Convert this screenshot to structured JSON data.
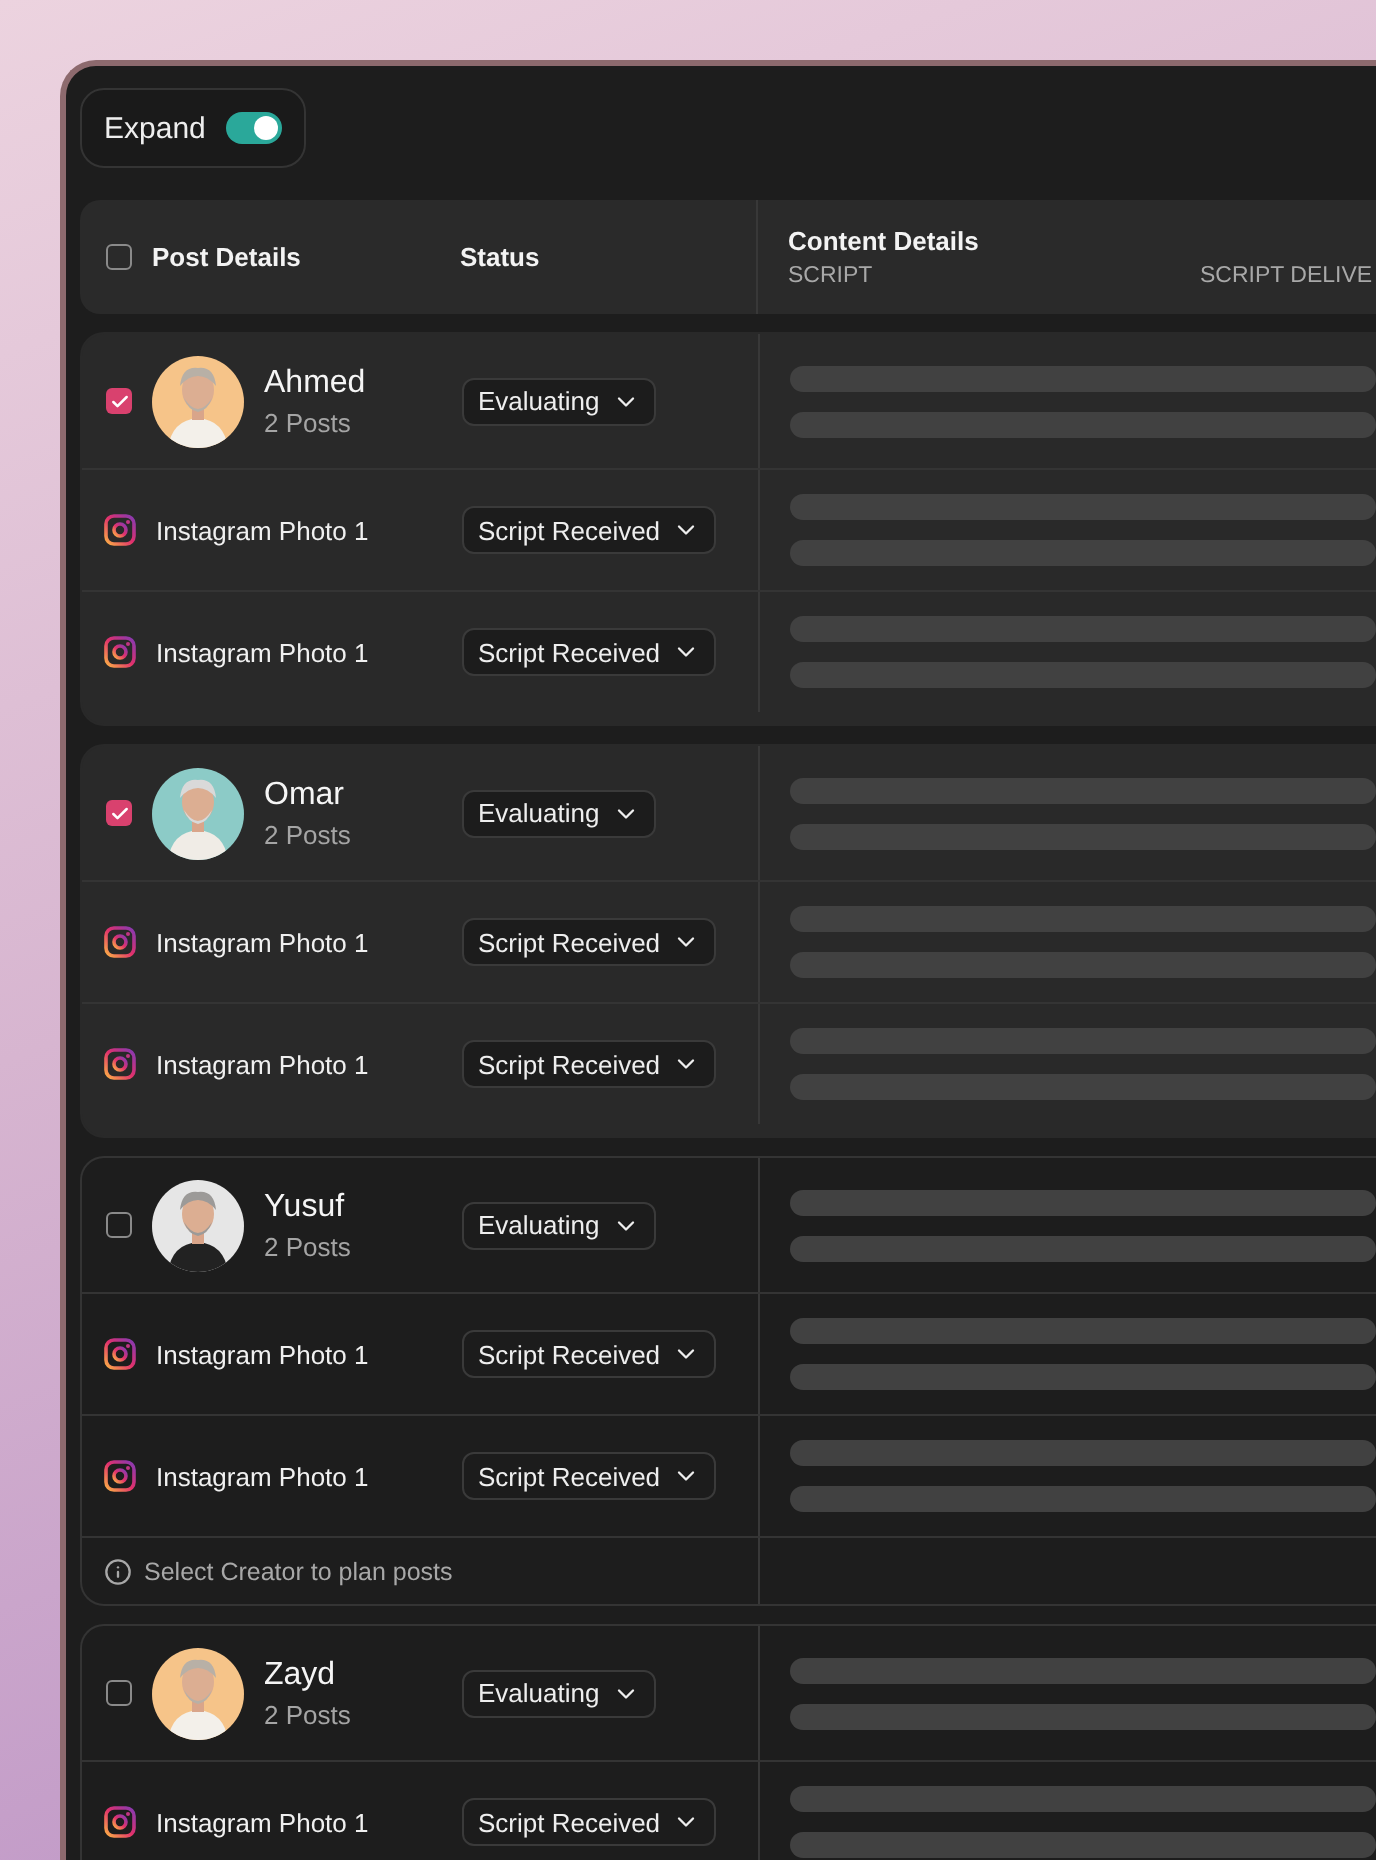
{
  "toggle": {
    "label": "Expand",
    "on": true
  },
  "header": {
    "checked": false,
    "post_details": "Post Details",
    "status": "Status",
    "content_details": "Content Details",
    "subcolumns": [
      "SCRIPT",
      "SCRIPT DELIVE"
    ]
  },
  "creators": [
    {
      "name": "Ahmed",
      "posts": "2 Posts",
      "checked": true,
      "status": "Evaluating",
      "items": [
        {
          "title": "Instagram Photo 1",
          "status": "Script Received"
        },
        {
          "title": "Instagram Photo 1",
          "status": "Script Received"
        }
      ]
    },
    {
      "name": "Omar",
      "posts": "2 Posts",
      "checked": true,
      "status": "Evaluating",
      "items": [
        {
          "title": "Instagram Photo 1",
          "status": "Script Received"
        },
        {
          "title": "Instagram Photo 1",
          "status": "Script Received"
        }
      ]
    },
    {
      "name": "Yusuf",
      "posts": "2 Posts",
      "checked": false,
      "status": "Evaluating",
      "hint": "Select Creator to plan posts",
      "items": [
        {
          "title": "Instagram Photo 1",
          "status": "Script Received"
        },
        {
          "title": "Instagram Photo 1",
          "status": "Script Received"
        }
      ]
    },
    {
      "name": "Zayd",
      "posts": "2 Posts",
      "checked": false,
      "status": "Evaluating",
      "items": [
        {
          "title": "Instagram Photo 1",
          "status": "Script Received"
        }
      ]
    }
  ]
}
